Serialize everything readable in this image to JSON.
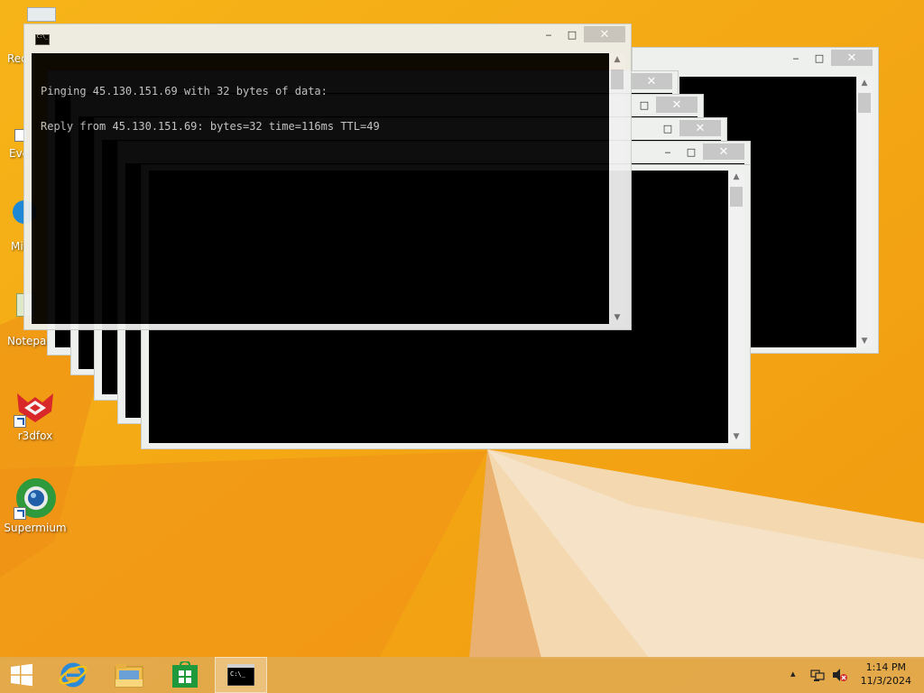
{
  "colors": {
    "wallpaper_orange": "#f5a814",
    "console_bg": "#000000",
    "console_text": "#c0c0c0",
    "window_frame": "#eef0ee",
    "taskbar": "#e1aa50"
  },
  "desktop": {
    "icons": [
      {
        "name": "Recycle Bin",
        "label": "Rec",
        "icon": "recycle-bin-icon"
      },
      {
        "name": "Everything",
        "label": "Eve",
        "icon": "everything-icon"
      },
      {
        "name": "Microsoft Edge",
        "label": "Mi",
        "icon": "edge-icon"
      },
      {
        "name": "Notepad",
        "label": "Notepad",
        "icon": "notepad-icon"
      },
      {
        "name": "r3dfox",
        "label": "r3dfox",
        "icon": "r3dfox-icon"
      },
      {
        "name": "Supermium",
        "label": "Supermium",
        "icon": "supermium-icon"
      }
    ]
  },
  "console": {
    "title_icon": "cmd-icon",
    "buttons": {
      "minimize": "‒",
      "maximize": "□",
      "close": "✕"
    },
    "lines": [
      "Pinging 45.130.151.69 with 32 bytes of data:",
      "Reply from 45.130.151.69: bytes=32 time=116ms TTL=49"
    ]
  },
  "taskbar": {
    "start": "start-windows-icon",
    "pinned": [
      {
        "name": "Internet Explorer",
        "icon": "internet-explorer-icon"
      },
      {
        "name": "File Explorer",
        "icon": "file-explorer-icon"
      },
      {
        "name": "Store",
        "icon": "store-icon"
      },
      {
        "name": "Command Prompt",
        "icon": "command-prompt-icon",
        "active": true
      }
    ],
    "tray": {
      "chevron": "▴",
      "time": "1:14 PM",
      "date": "11/3/2024"
    }
  }
}
